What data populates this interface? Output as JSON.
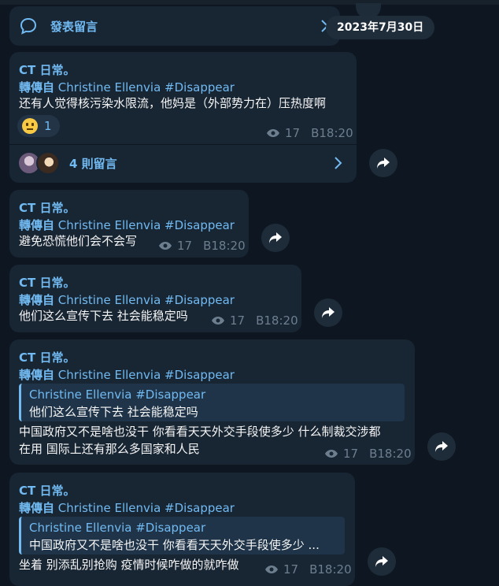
{
  "date_pill": "2023年7月30日",
  "top_bar": {
    "label": "發表留言"
  },
  "messages": [
    {
      "author": "CT 日常。",
      "fwd_prefix": "轉傳自",
      "fwd_source": "Christine Ellenvia #Disappear",
      "text": "还有人觉得核污染水限流，他妈是（外部势力在）压热度啊",
      "reaction_count": "1",
      "views": "17",
      "time": "B18:20",
      "comments_label": "4 則留言"
    },
    {
      "author": "CT 日常。",
      "fwd_prefix": "轉傳自",
      "fwd_source": "Christine Ellenvia #Disappear",
      "text": "避免恐慌他们会不会写",
      "views": "17",
      "time": "B18:20"
    },
    {
      "author": "CT 日常。",
      "fwd_prefix": "轉傳自",
      "fwd_source": "Christine Ellenvia #Disappear",
      "text": "他们这么宣传下去 社会能稳定吗",
      "views": "17",
      "time": "B18:20"
    },
    {
      "author": "CT 日常。",
      "fwd_prefix": "轉傳自",
      "fwd_source": "Christine Ellenvia #Disappear",
      "quote_title": "Christine Ellenvia #Disappear",
      "quote_text": "他们这么宣传下去 社会能稳定吗",
      "text_line1": "中国政府又不是啥也没干 你看看天天外交手段使多少 什么制裁交涉都",
      "text_line2": "在用 国际上还有那么多国家和人民",
      "views": "17",
      "time": "B18:20"
    },
    {
      "author": "CT 日常。",
      "fwd_prefix": "轉傳自",
      "fwd_source": "Christine Ellenvia #Disappear",
      "quote_title": "Christine Ellenvia #Disappear",
      "quote_text": "中国政府又不是啥也没干 你看看天天外交手段使多少 ...",
      "text": "坐着 别添乱别抢购 疫情时候咋做的就咋做",
      "views": "17",
      "time": "B18:20"
    }
  ]
}
